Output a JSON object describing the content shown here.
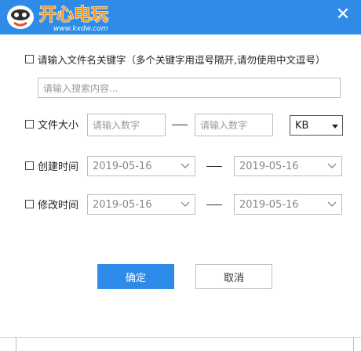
{
  "header": {
    "logo_text": "开心电玩",
    "logo_sub": "www.kxdw.com",
    "close_icon": "close-icon",
    "accent": "#2f8be8"
  },
  "keyword": {
    "label": "请输入文件名关键字（多个关键字用逗号隔开,请勿使用中文逗号）",
    "placeholder": "请输入搜索内容..."
  },
  "size": {
    "label": "文件大小",
    "min_placeholder": "请输入数字",
    "max_placeholder": "请输入数字",
    "unit": "KB"
  },
  "created": {
    "label": "创建时间",
    "from": "2019-05-16",
    "to": "2019-05-16"
  },
  "modified": {
    "label": "修改时间",
    "from": "2019-05-16",
    "to": "2019-05-16"
  },
  "buttons": {
    "ok": "确定",
    "cancel": "取消"
  }
}
